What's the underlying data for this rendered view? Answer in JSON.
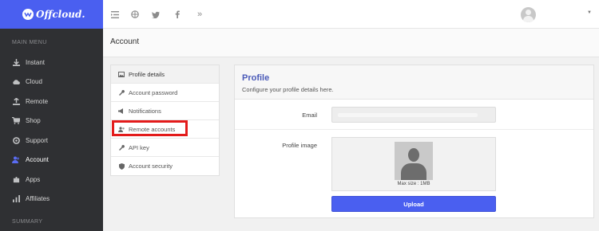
{
  "brand": {
    "name": "Offcloud."
  },
  "sidebar": {
    "main_menu_label": "MAIN MENU",
    "summary_label": "SUMMARY",
    "items": [
      {
        "label": "Instant",
        "icon": "download-icon"
      },
      {
        "label": "Cloud",
        "icon": "cloud-icon"
      },
      {
        "label": "Remote",
        "icon": "upload-icon"
      },
      {
        "label": "Shop",
        "icon": "cart-icon"
      },
      {
        "label": "Support",
        "icon": "lifebuoy-icon"
      },
      {
        "label": "Account",
        "icon": "users-icon",
        "active": true
      },
      {
        "label": "Apps",
        "icon": "puzzle-icon"
      },
      {
        "label": "Affiliates",
        "icon": "chart-icon"
      }
    ]
  },
  "topbar": {
    "icons": [
      "menu-toggle-icon",
      "globe-icon",
      "twitter-icon",
      "facebook-icon",
      "double-chevron-icon"
    ]
  },
  "page": {
    "title": "Account"
  },
  "tabs": [
    {
      "label": "Profile details",
      "icon": "image-icon",
      "active": true
    },
    {
      "label": "Account password",
      "icon": "wrench-icon"
    },
    {
      "label": "Notifications",
      "icon": "megaphone-icon"
    },
    {
      "label": "Remote accounts",
      "icon": "users-icon",
      "highlighted": true
    },
    {
      "label": "API key",
      "icon": "wrench-icon"
    },
    {
      "label": "Account security",
      "icon": "shield-icon"
    }
  ],
  "profile": {
    "title": "Profile",
    "subtitle": "Configure your profile details here.",
    "email_label": "Email",
    "email_value": "",
    "image_label": "Profile image",
    "image_caption": "Max size : 1MB",
    "upload_label": "Upload"
  },
  "colors": {
    "accent": "#4a5ff0",
    "highlight": "#e31b1b",
    "sidebar": "#2f3033"
  }
}
